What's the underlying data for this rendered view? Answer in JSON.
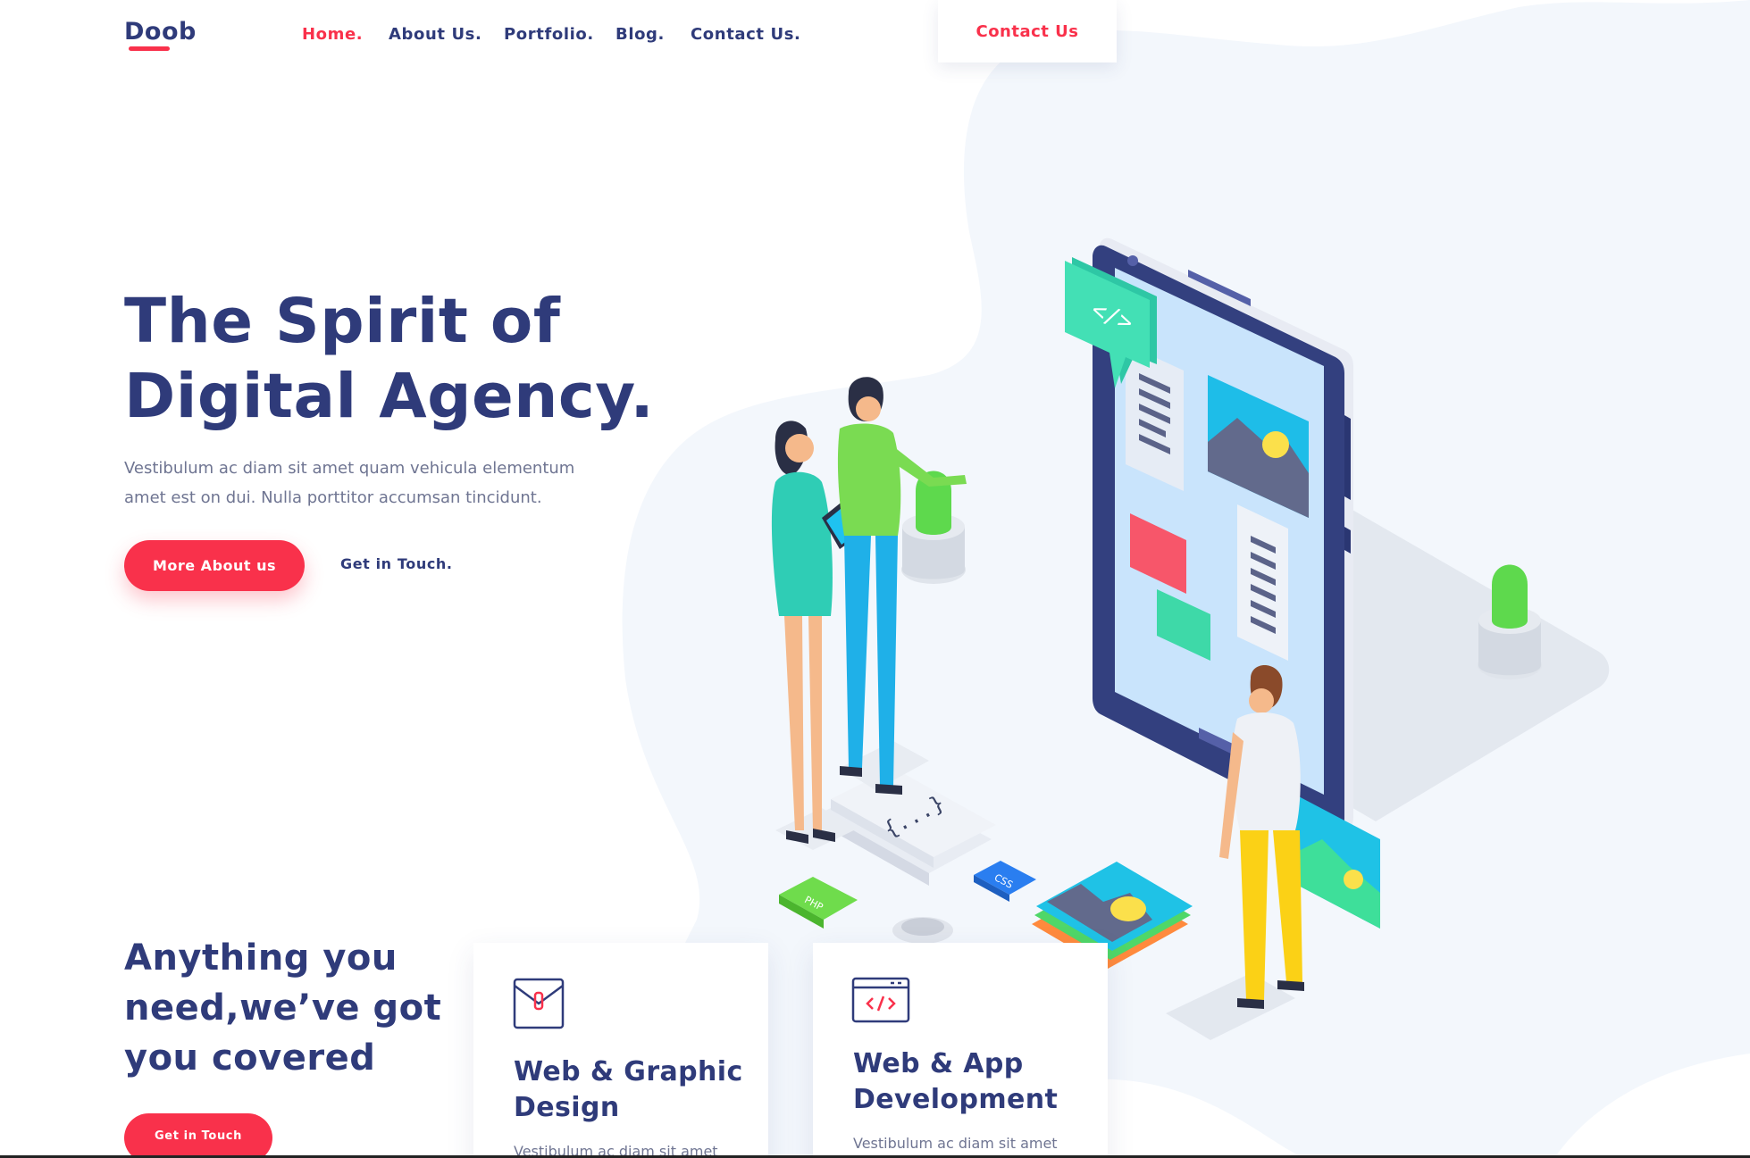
{
  "brand": {
    "name": "Doob",
    "accent": "#f9314b",
    "primary": "#2f3b7a",
    "muted": "#6f7592"
  },
  "nav": {
    "items": [
      {
        "label": "Home.",
        "active": true
      },
      {
        "label": "About Us."
      },
      {
        "label": "Portfolio."
      },
      {
        "label": "Blog."
      },
      {
        "label": "Contact Us."
      }
    ],
    "cta": "Contact Us"
  },
  "hero": {
    "title_line1": "The Spirit of",
    "title_line2": "Digital Agency.",
    "text_line1": "Vestibulum ac diam sit amet quam vehicula elementum",
    "text_line2": "amet est on dui. Nulla porttitor accumsan tincidunt.",
    "primary_button": "More About us",
    "secondary_link": "Get in Touch.",
    "illustration_tags": {
      "code": "</>",
      "braces": "{...}",
      "css": "CSS",
      "php": "PHP"
    }
  },
  "services": {
    "title_line1": "Anything you",
    "title_line2": "need,we’ve got",
    "title_line3": "you covered",
    "button": "Get in Touch",
    "cards": [
      {
        "icon": "envelope-icon",
        "title_line1": "Web & Graphic",
        "title_line2": "Design",
        "text": "Vestibulum ac diam sit amet"
      },
      {
        "icon": "code-window-icon",
        "title_line1": "Web & App",
        "title_line2": "Development",
        "text": "Vestibulum ac diam sit amet"
      }
    ]
  }
}
